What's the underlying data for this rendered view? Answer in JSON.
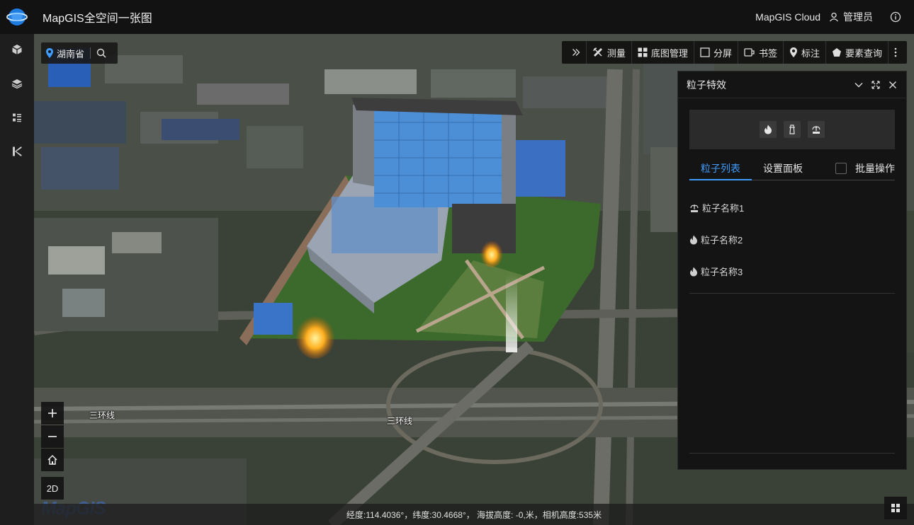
{
  "app": {
    "title": "MapGIS全空间一张图"
  },
  "header": {
    "cloud_label": "MapGIS Cloud",
    "user_label": "管理员"
  },
  "search": {
    "region": "湖南省"
  },
  "toolbar": {
    "items": [
      {
        "label": "测量",
        "icon": "ruler-icon"
      },
      {
        "label": "底图管理",
        "icon": "grid-icon"
      },
      {
        "label": "分屏",
        "icon": "split-screen-icon"
      },
      {
        "label": "书签",
        "icon": "bookmark-icon"
      },
      {
        "label": "标注",
        "icon": "pin-icon"
      },
      {
        "label": "要素查询",
        "icon": "pentagon-icon"
      }
    ]
  },
  "panel": {
    "title": "粒子特效",
    "effect_types": [
      "fire-icon",
      "smoke-icon",
      "fountain-icon"
    ],
    "tabs": [
      {
        "label": "粒子列表",
        "active": true
      },
      {
        "label": "设置面板",
        "active": false
      }
    ],
    "batch_label": "批量操作",
    "particles": [
      {
        "name": "粒子名称1",
        "icon": "fountain-icon"
      },
      {
        "name": "粒子名称2",
        "icon": "fire-icon"
      },
      {
        "name": "粒子名称3",
        "icon": "fire-icon"
      }
    ]
  },
  "map": {
    "road_labels": [
      "三环线",
      "三环线"
    ],
    "two_d_label": "2D",
    "status": "经度:114.4036°，纬度:30.4668°， 海拔高度: -0,米，相机高度:535米",
    "brand": "MapGIS"
  },
  "colors": {
    "accent": "#3e9cff",
    "panel_bg": "#141414",
    "topbar_bg": "#121212"
  }
}
